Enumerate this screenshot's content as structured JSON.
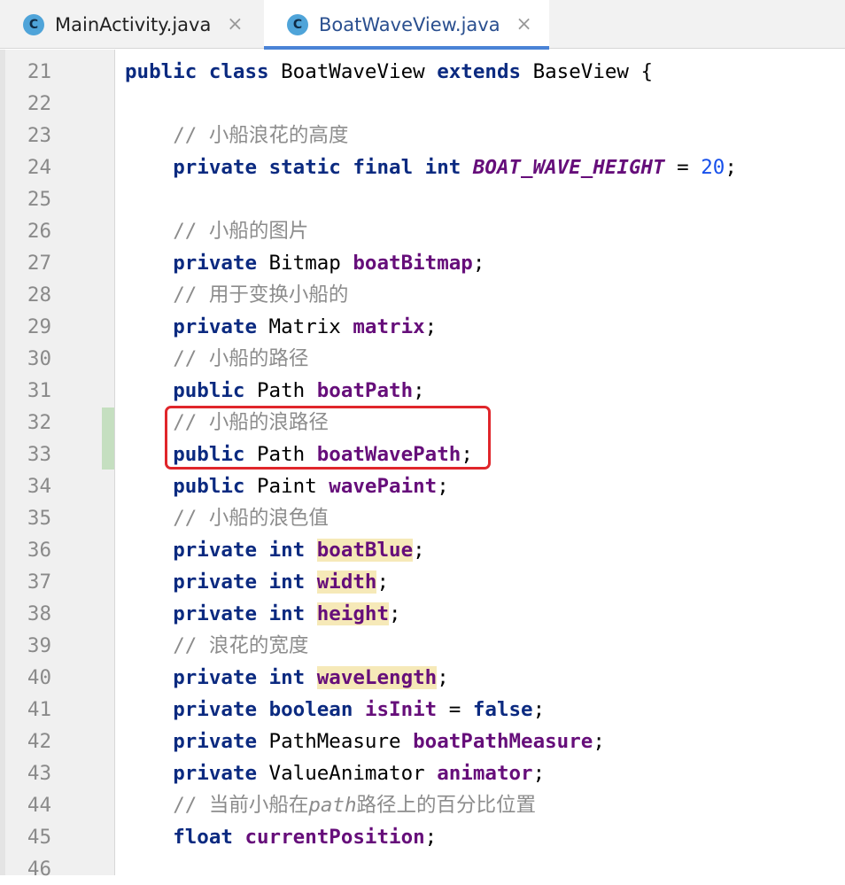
{
  "tabs": [
    {
      "icon": "C",
      "label": "MainActivity.java",
      "active": false
    },
    {
      "icon": "C",
      "label": "BoatWaveView.java",
      "active": true
    }
  ],
  "close_glyph": "×",
  "lines": [
    {
      "n": "21",
      "tokens": [
        [
          "kw",
          "public"
        ],
        [
          "",
          " "
        ],
        [
          "kw",
          "class"
        ],
        [
          "",
          " BoatWaveView "
        ],
        [
          "kw",
          "extends"
        ],
        [
          "",
          " BaseView {"
        ]
      ]
    },
    {
      "n": "22",
      "tokens": []
    },
    {
      "n": "23",
      "tokens": [
        [
          "",
          "    "
        ],
        [
          "cmt",
          "// 小船浪花的高度"
        ]
      ]
    },
    {
      "n": "24",
      "tokens": [
        [
          "",
          "    "
        ],
        [
          "kw",
          "private"
        ],
        [
          "",
          " "
        ],
        [
          "kw",
          "static"
        ],
        [
          "",
          " "
        ],
        [
          "kw",
          "final"
        ],
        [
          "",
          " "
        ],
        [
          "kw",
          "int"
        ],
        [
          "",
          " "
        ],
        [
          "cst",
          "BOAT_WAVE_HEIGHT"
        ],
        [
          "",
          " = "
        ],
        [
          "num",
          "20"
        ],
        [
          "",
          ";"
        ]
      ]
    },
    {
      "n": "25",
      "tokens": []
    },
    {
      "n": "26",
      "tokens": [
        [
          "",
          "    "
        ],
        [
          "cmt",
          "// 小船的图片"
        ]
      ]
    },
    {
      "n": "27",
      "tokens": [
        [
          "",
          "    "
        ],
        [
          "kw",
          "private"
        ],
        [
          "",
          " Bitmap "
        ],
        [
          "fld",
          "boatBitmap"
        ],
        [
          "",
          ";"
        ]
      ]
    },
    {
      "n": "28",
      "tokens": [
        [
          "",
          "    "
        ],
        [
          "cmt",
          "// 用于变换小船的"
        ]
      ]
    },
    {
      "n": "29",
      "tokens": [
        [
          "",
          "    "
        ],
        [
          "kw",
          "private"
        ],
        [
          "",
          " Matrix "
        ],
        [
          "fld",
          "matrix"
        ],
        [
          "",
          ";"
        ]
      ]
    },
    {
      "n": "30",
      "tokens": [
        [
          "",
          "    "
        ],
        [
          "cmt",
          "// 小船的路径"
        ]
      ]
    },
    {
      "n": "31",
      "tokens": [
        [
          "",
          "    "
        ],
        [
          "kw",
          "public"
        ],
        [
          "",
          " Path "
        ],
        [
          "fld",
          "boatPath"
        ],
        [
          "",
          ";"
        ]
      ]
    },
    {
      "n": "32",
      "tokens": [
        [
          "",
          "    "
        ],
        [
          "cmt",
          "// 小船的浪路径"
        ]
      ]
    },
    {
      "n": "33",
      "tokens": [
        [
          "",
          "    "
        ],
        [
          "kw",
          "public"
        ],
        [
          "",
          " Path "
        ],
        [
          "fld",
          "boatWavePath"
        ],
        [
          "",
          ";"
        ]
      ]
    },
    {
      "n": "34",
      "tokens": [
        [
          "",
          "    "
        ],
        [
          "kw",
          "public"
        ],
        [
          "",
          " Paint "
        ],
        [
          "fld",
          "wavePaint"
        ],
        [
          "",
          ";"
        ]
      ]
    },
    {
      "n": "35",
      "tokens": [
        [
          "",
          "    "
        ],
        [
          "cmt",
          "// 小船的浪色值"
        ]
      ]
    },
    {
      "n": "36",
      "tokens": [
        [
          "",
          "    "
        ],
        [
          "kw",
          "private"
        ],
        [
          "",
          " "
        ],
        [
          "kw",
          "int"
        ],
        [
          "",
          " "
        ],
        [
          "fld hl",
          "boatBlue"
        ],
        [
          "",
          ";"
        ]
      ]
    },
    {
      "n": "37",
      "tokens": [
        [
          "",
          "    "
        ],
        [
          "kw",
          "private"
        ],
        [
          "",
          " "
        ],
        [
          "kw",
          "int"
        ],
        [
          "",
          " "
        ],
        [
          "fld hl",
          "width"
        ],
        [
          "",
          ";"
        ]
      ]
    },
    {
      "n": "38",
      "tokens": [
        [
          "",
          "    "
        ],
        [
          "kw",
          "private"
        ],
        [
          "",
          " "
        ],
        [
          "kw",
          "int"
        ],
        [
          "",
          " "
        ],
        [
          "fld hl",
          "height"
        ],
        [
          "",
          ";"
        ]
      ]
    },
    {
      "n": "39",
      "tokens": [
        [
          "",
          "    "
        ],
        [
          "cmt",
          "// 浪花的宽度"
        ]
      ]
    },
    {
      "n": "40",
      "tokens": [
        [
          "",
          "    "
        ],
        [
          "kw",
          "private"
        ],
        [
          "",
          " "
        ],
        [
          "kw",
          "int"
        ],
        [
          "",
          " "
        ],
        [
          "fld hl",
          "waveLength"
        ],
        [
          "",
          ";"
        ]
      ]
    },
    {
      "n": "41",
      "tokens": [
        [
          "",
          "    "
        ],
        [
          "kw",
          "private"
        ],
        [
          "",
          " "
        ],
        [
          "kw",
          "boolean"
        ],
        [
          "",
          " "
        ],
        [
          "fld",
          "isInit"
        ],
        [
          "",
          " = "
        ],
        [
          "kw",
          "false"
        ],
        [
          "",
          ";"
        ]
      ]
    },
    {
      "n": "42",
      "tokens": [
        [
          "",
          "    "
        ],
        [
          "kw",
          "private"
        ],
        [
          "",
          " PathMeasure "
        ],
        [
          "fld",
          "boatPathMeasure"
        ],
        [
          "",
          ";"
        ]
      ]
    },
    {
      "n": "43",
      "tokens": [
        [
          "",
          "    "
        ],
        [
          "kw",
          "private"
        ],
        [
          "",
          " ValueAnimator "
        ],
        [
          "fld",
          "animator"
        ],
        [
          "",
          ";"
        ]
      ]
    },
    {
      "n": "44",
      "tokens": [
        [
          "",
          "    "
        ],
        [
          "cmt",
          "// 当前小船在"
        ],
        [
          "cmt-i",
          "path"
        ],
        [
          "cmt",
          "路径上的百分比位置"
        ]
      ]
    },
    {
      "n": "45",
      "tokens": [
        [
          "",
          "    "
        ],
        [
          "kw",
          "float"
        ],
        [
          "",
          " "
        ],
        [
          "fld",
          "currentPosition"
        ],
        [
          "",
          ";"
        ]
      ]
    },
    {
      "n": "46",
      "tokens": []
    }
  ]
}
